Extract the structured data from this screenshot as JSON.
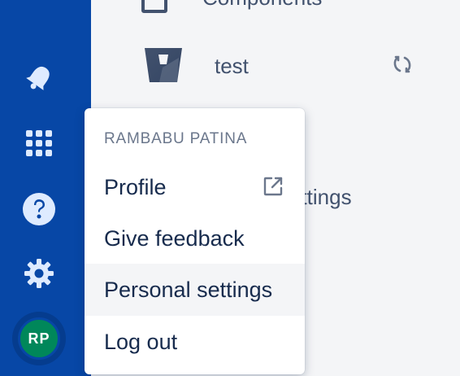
{
  "sidebar": {
    "components_label": "Components",
    "project_label": "test",
    "settings_label_partial": "ettings"
  },
  "global_nav": {
    "icons": [
      "notification-icon",
      "app-switcher-icon",
      "help-icon",
      "settings-icon"
    ],
    "avatar_initials": "RP"
  },
  "user_menu": {
    "heading": "RAMBABU PATINA",
    "items": [
      {
        "label": "Profile",
        "icon": "external-link-icon"
      },
      {
        "label": "Give feedback"
      },
      {
        "label": "Personal settings"
      },
      {
        "label": "Log out"
      }
    ]
  },
  "colors": {
    "nav_bg": "#0747A6",
    "avatar_bg": "#00875A",
    "sidebar_bg": "#F4F5F7",
    "menu_bg": "#FFFFFF",
    "text_primary": "#172B4D",
    "text_subtle": "#6B778C"
  }
}
